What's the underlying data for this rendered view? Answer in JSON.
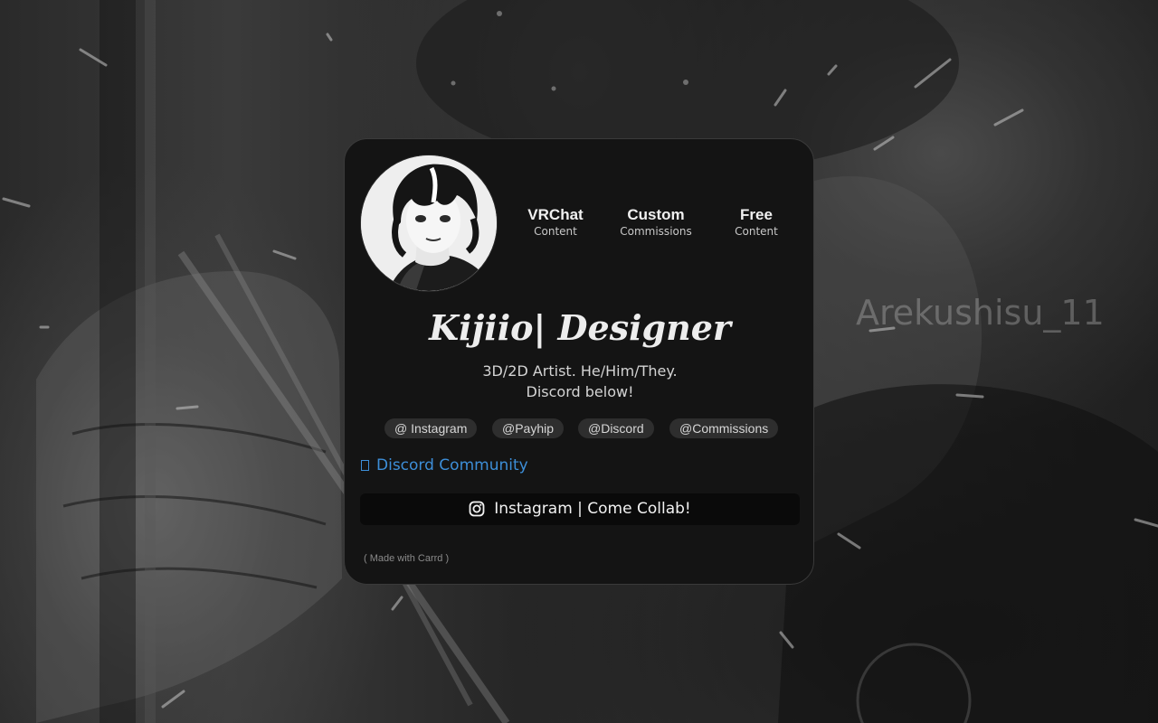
{
  "background": {
    "watermark": "Arekushisu_11"
  },
  "profile": {
    "avatar": "anime-avatar-portrait",
    "stats": [
      {
        "label": "VRChat",
        "sub": "Content"
      },
      {
        "label": "Custom",
        "sub": "Commissions"
      },
      {
        "label": "Free",
        "sub": "Content"
      }
    ],
    "title": "Kijiio| Designer",
    "bio_line1": "3D/2D Artist. He/Him/They.",
    "bio_line2": "Discord below!"
  },
  "tags": [
    {
      "label": "@ Instagram"
    },
    {
      "label": "@Payhip"
    },
    {
      "label": "@Discord"
    },
    {
      "label": "@Commissions"
    }
  ],
  "discord_link": {
    "icon": "discord-icon",
    "label": "Discord Community",
    "color": "#3d8ed8"
  },
  "instagram_button": {
    "icon": "instagram-icon",
    "label": "Instagram | Come Collab!"
  },
  "footer": {
    "made_with": "( Made with Carrd )"
  },
  "colors": {
    "card_bg": "#141414",
    "tag_bg": "#2e2e2e",
    "button_bg": "#0a0a0a"
  }
}
